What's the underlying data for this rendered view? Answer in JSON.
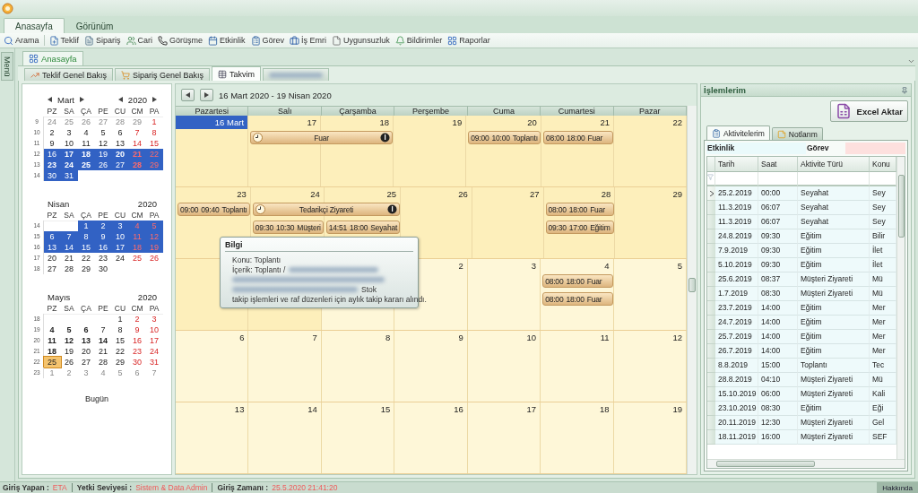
{
  "ribbon_tabs": [
    {
      "label": "Anasayfa",
      "selected": true
    },
    {
      "label": "Görünüm",
      "selected": false
    }
  ],
  "toolbar": [
    "Arama",
    "Teklif",
    "Sipariş",
    "Cari",
    "Görüşme",
    "Etkinlik",
    "Görev",
    "İş Emri",
    "Uygunsuzluk",
    "Bildirimler",
    "Raporlar"
  ],
  "side_strip": {
    "label": "Menü"
  },
  "document_tab": {
    "label": "Anasayfa"
  },
  "view_tabs": [
    {
      "label": "Teklif Genel Bakış",
      "selected": false
    },
    {
      "label": "Sipariş Genel Bakış",
      "selected": false
    },
    {
      "label": "Takvim",
      "selected": true
    }
  ],
  "mini_calendars": [
    {
      "month": "Mart",
      "year": "2020",
      "navigation": true,
      "weekdays": [
        "PZ",
        "SA",
        "ÇA",
        "PE",
        "CU",
        "CM",
        "PA"
      ],
      "weeks": [
        {
          "number": "9",
          "days": [
            {
              "label": "24",
              "muted": true,
              "bold": false,
              "selected": false,
              "today": false
            },
            {
              "label": "25",
              "muted": true,
              "bold": false,
              "selected": false,
              "today": false
            },
            {
              "label": "26",
              "muted": true,
              "bold": false,
              "selected": false,
              "today": false
            },
            {
              "label": "27",
              "muted": true,
              "bold": false,
              "selected": false,
              "today": false
            },
            {
              "label": "28",
              "muted": true,
              "bold": false,
              "selected": false,
              "today": false
            },
            {
              "label": "29",
              "muted": true,
              "bold": false,
              "selected": false,
              "today": false
            },
            {
              "label": "1",
              "muted": false,
              "bold": false,
              "selected": false,
              "today": false
            }
          ]
        },
        {
          "number": "10",
          "days": [
            {
              "label": "2",
              "muted": false,
              "bold": false,
              "selected": false,
              "today": false
            },
            {
              "label": "3",
              "muted": false,
              "bold": false,
              "selected": false,
              "today": false
            },
            {
              "label": "4",
              "muted": false,
              "bold": false,
              "selected": false,
              "today": false
            },
            {
              "label": "5",
              "muted": false,
              "bold": false,
              "selected": false,
              "today": false
            },
            {
              "label": "6",
              "muted": false,
              "bold": false,
              "selected": false,
              "today": false
            },
            {
              "label": "7",
              "muted": false,
              "bold": false,
              "selected": false,
              "today": false
            },
            {
              "label": "8",
              "muted": false,
              "bold": false,
              "selected": false,
              "today": false
            }
          ]
        },
        {
          "number": "11",
          "days": [
            {
              "label": "9",
              "muted": false,
              "bold": false,
              "selected": false,
              "today": false
            },
            {
              "label": "10",
              "muted": false,
              "bold": false,
              "selected": false,
              "today": false
            },
            {
              "label": "11",
              "muted": false,
              "bold": false,
              "selected": false,
              "today": false
            },
            {
              "label": "12",
              "muted": false,
              "bold": false,
              "selected": false,
              "today": false
            },
            {
              "label": "13",
              "muted": false,
              "bold": false,
              "selected": false,
              "today": false
            },
            {
              "label": "14",
              "muted": false,
              "bold": false,
              "selected": false,
              "today": false
            },
            {
              "label": "15",
              "muted": false,
              "bold": false,
              "selected": false,
              "today": false
            }
          ]
        },
        {
          "number": "12",
          "days": [
            {
              "label": "16",
              "muted": false,
              "bold": false,
              "selected": true,
              "today": false
            },
            {
              "label": "17",
              "muted": false,
              "bold": true,
              "selected": true,
              "today": false
            },
            {
              "label": "18",
              "muted": false,
              "bold": true,
              "selected": true,
              "today": false
            },
            {
              "label": "19",
              "muted": false,
              "bold": false,
              "selected": true,
              "today": false
            },
            {
              "label": "20",
              "muted": false,
              "bold": true,
              "selected": true,
              "today": false
            },
            {
              "label": "21",
              "muted": false,
              "bold": true,
              "selected": true,
              "today": false
            },
            {
              "label": "22",
              "muted": false,
              "bold": false,
              "selected": true,
              "today": false
            }
          ]
        },
        {
          "number": "13",
          "days": [
            {
              "label": "23",
              "muted": false,
              "bold": true,
              "selected": true,
              "today": false
            },
            {
              "label": "24",
              "muted": false,
              "bold": true,
              "selected": true,
              "today": false
            },
            {
              "label": "25",
              "muted": false,
              "bold": true,
              "selected": true,
              "today": false
            },
            {
              "label": "26",
              "muted": false,
              "bold": false,
              "selected": true,
              "today": false
            },
            {
              "label": "27",
              "muted": false,
              "bold": false,
              "selected": true,
              "today": false
            },
            {
              "label": "28",
              "muted": false,
              "bold": true,
              "selected": true,
              "today": false
            },
            {
              "label": "29",
              "muted": false,
              "bold": false,
              "selected": true,
              "today": false
            }
          ]
        },
        {
          "number": "14",
          "days": [
            {
              "label": "30",
              "muted": false,
              "bold": false,
              "selected": true,
              "today": false
            },
            {
              "label": "31",
              "muted": false,
              "bold": false,
              "selected": true,
              "today": false
            }
          ]
        }
      ]
    },
    {
      "month": "Nisan",
      "year": "2020",
      "navigation": false,
      "weekdays": [
        "PZ",
        "SA",
        "ÇA",
        "PE",
        "CU",
        "CM",
        "PA"
      ],
      "weeks": [
        {
          "number": "14",
          "days": [
            {
              "label": "1",
              "muted": false,
              "bold": false,
              "selected": true,
              "today": false
            },
            {
              "label": "2",
              "muted": false,
              "bold": false,
              "selected": true,
              "today": false
            },
            {
              "label": "3",
              "muted": false,
              "bold": false,
              "selected": true,
              "today": false
            },
            {
              "label": "4",
              "muted": false,
              "bold": false,
              "selected": true,
              "today": false
            },
            {
              "label": "5",
              "muted": false,
              "bold": false,
              "selected": true,
              "today": false
            }
          ]
        },
        {
          "number": "15",
          "days": [
            {
              "label": "6",
              "muted": false,
              "bold": false,
              "selected": true,
              "today": false
            },
            {
              "label": "7",
              "muted": false,
              "bold": false,
              "selected": true,
              "today": false
            },
            {
              "label": "8",
              "muted": false,
              "bold": false,
              "selected": true,
              "today": false
            },
            {
              "label": "9",
              "muted": false,
              "bold": false,
              "selected": true,
              "today": false
            },
            {
              "label": "10",
              "muted": false,
              "bold": false,
              "selected": true,
              "today": false
            },
            {
              "label": "11",
              "muted": false,
              "bold": false,
              "selected": true,
              "today": false
            },
            {
              "label": "12",
              "muted": false,
              "bold": false,
              "selected": true,
              "today": false
            }
          ]
        },
        {
          "number": "16",
          "days": [
            {
              "label": "13",
              "muted": false,
              "bold": false,
              "selected": true,
              "today": false
            },
            {
              "label": "14",
              "muted": false,
              "bold": false,
              "selected": true,
              "today": false
            },
            {
              "label": "15",
              "muted": false,
              "bold": false,
              "selected": true,
              "today": false
            },
            {
              "label": "16",
              "muted": false,
              "bold": false,
              "selected": true,
              "today": false
            },
            {
              "label": "17",
              "muted": false,
              "bold": false,
              "selected": true,
              "today": false
            },
            {
              "label": "18",
              "muted": false,
              "bold": false,
              "selected": true,
              "today": false
            },
            {
              "label": "19",
              "muted": false,
              "bold": false,
              "selected": true,
              "today": false
            }
          ]
        },
        {
          "number": "17",
          "days": [
            {
              "label": "20",
              "muted": false,
              "bold": false,
              "selected": false,
              "today": false
            },
            {
              "label": "21",
              "muted": false,
              "bold": false,
              "selected": false,
              "today": false
            },
            {
              "label": "22",
              "muted": false,
              "bold": false,
              "selected": false,
              "today": false
            },
            {
              "label": "23",
              "muted": false,
              "bold": false,
              "selected": false,
              "today": false
            },
            {
              "label": "24",
              "muted": false,
              "bold": false,
              "selected": false,
              "today": false
            },
            {
              "label": "25",
              "muted": false,
              "bold": false,
              "selected": false,
              "today": false
            },
            {
              "label": "26",
              "muted": false,
              "bold": false,
              "selected": false,
              "today": false
            }
          ]
        },
        {
          "number": "18",
          "days": [
            {
              "label": "27",
              "muted": false,
              "bold": false,
              "selected": false,
              "today": false
            },
            {
              "label": "28",
              "muted": false,
              "bold": false,
              "selected": false,
              "today": false
            },
            {
              "label": "29",
              "muted": false,
              "bold": false,
              "selected": false,
              "today": false
            },
            {
              "label": "30",
              "muted": false,
              "bold": false,
              "selected": false,
              "today": false
            }
          ]
        }
      ]
    },
    {
      "month": "Mayıs",
      "year": "2020",
      "navigation": false,
      "weekdays": [
        "PZ",
        "SA",
        "ÇA",
        "PE",
        "CU",
        "CM",
        "PA"
      ],
      "weeks": [
        {
          "number": "18",
          "days": [
            {
              "label": "1",
              "muted": false,
              "bold": false,
              "selected": false,
              "today": false
            },
            {
              "label": "2",
              "muted": false,
              "bold": false,
              "selected": false,
              "today": false
            },
            {
              "label": "3",
              "muted": false,
              "bold": false,
              "selected": false,
              "today": false
            }
          ]
        },
        {
          "number": "19",
          "days": [
            {
              "label": "4",
              "muted": false,
              "bold": true,
              "selected": false,
              "today": false
            },
            {
              "label": "5",
              "muted": false,
              "bold": true,
              "selected": false,
              "today": false
            },
            {
              "label": "6",
              "muted": false,
              "bold": true,
              "selected": false,
              "today": false
            },
            {
              "label": "7",
              "muted": false,
              "bold": false,
              "selected": false,
              "today": false
            },
            {
              "label": "8",
              "muted": false,
              "bold": false,
              "selected": false,
              "today": false
            },
            {
              "label": "9",
              "muted": false,
              "bold": false,
              "selected": false,
              "today": false
            },
            {
              "label": "10",
              "muted": false,
              "bold": false,
              "selected": false,
              "today": false
            }
          ]
        },
        {
          "number": "20",
          "days": [
            {
              "label": "11",
              "muted": false,
              "bold": true,
              "selected": false,
              "today": false
            },
            {
              "label": "12",
              "muted": false,
              "bold": true,
              "selected": false,
              "today": false
            },
            {
              "label": "13",
              "muted": false,
              "bold": true,
              "selected": false,
              "today": false
            },
            {
              "label": "14",
              "muted": false,
              "bold": true,
              "selected": false,
              "today": false
            },
            {
              "label": "15",
              "muted": false,
              "bold": false,
              "selected": false,
              "today": false
            },
            {
              "label": "16",
              "muted": false,
              "bold": false,
              "selected": false,
              "today": false
            },
            {
              "label": "17",
              "muted": false,
              "bold": false,
              "selected": false,
              "today": false
            }
          ]
        },
        {
          "number": "21",
          "days": [
            {
              "label": "18",
              "muted": false,
              "bold": true,
              "selected": false,
              "today": false
            },
            {
              "label": "19",
              "muted": false,
              "bold": false,
              "selected": false,
              "today": false
            },
            {
              "label": "20",
              "muted": false,
              "bold": false,
              "selected": false,
              "today": false
            },
            {
              "label": "21",
              "muted": false,
              "bold": false,
              "selected": false,
              "today": false
            },
            {
              "label": "22",
              "muted": false,
              "bold": false,
              "selected": false,
              "today": false
            },
            {
              "label": "23",
              "muted": false,
              "bold": false,
              "selected": false,
              "today": false
            },
            {
              "label": "24",
              "muted": false,
              "bold": false,
              "selected": false,
              "today": false
            }
          ]
        },
        {
          "number": "22",
          "days": [
            {
              "label": "25",
              "muted": false,
              "bold": false,
              "selected": false,
              "today": true
            },
            {
              "label": "26",
              "muted": false,
              "bold": false,
              "selected": false,
              "today": false
            },
            {
              "label": "27",
              "muted": false,
              "bold": false,
              "selected": false,
              "today": false
            },
            {
              "label": "28",
              "muted": false,
              "bold": false,
              "selected": false,
              "today": false
            },
            {
              "label": "29",
              "muted": false,
              "bold": false,
              "selected": false,
              "today": false
            },
            {
              "label": "30",
              "muted": false,
              "bold": false,
              "selected": false,
              "today": false
            },
            {
              "label": "31",
              "muted": false,
              "bold": false,
              "selected": false,
              "today": false
            }
          ]
        },
        {
          "number": "23",
          "days": [
            {
              "label": "1",
              "muted": true,
              "bold": false,
              "selected": false,
              "today": false
            },
            {
              "label": "2",
              "muted": true,
              "bold": false,
              "selected": false,
              "today": false
            },
            {
              "label": "3",
              "muted": true,
              "bold": false,
              "selected": false,
              "today": false
            },
            {
              "label": "4",
              "muted": true,
              "bold": false,
              "selected": false,
              "today": false
            },
            {
              "label": "5",
              "muted": true,
              "bold": false,
              "selected": false,
              "today": false
            },
            {
              "label": "6",
              "muted": true,
              "bold": false,
              "selected": false,
              "today": false
            },
            {
              "label": "7",
              "muted": true,
              "bold": false,
              "selected": false,
              "today": false
            }
          ]
        }
      ]
    }
  ],
  "today_link": "Bugün",
  "calendar": {
    "range": "16 Mart 2020 - 19 Nisan 2020",
    "weekdays": [
      "Pazartesi",
      "Salı",
      "Çarşamba",
      "Perşembe",
      "Cuma",
      "Cumartesi",
      "Pazar"
    ],
    "weeks": [
      {
        "cells": [
          {
            "date": "16 Mart",
            "selected": true,
            "shaded": true
          },
          {
            "date": "17",
            "selected": false,
            "shaded": true,
            "events": [
              {
                "kind": "two_day",
                "title": "Fuar"
              }
            ]
          },
          {
            "date": "18",
            "selected": false,
            "shaded": true
          },
          {
            "date": "19",
            "selected": false,
            "shaded": true
          },
          {
            "date": "20",
            "selected": false,
            "shaded": true,
            "events": [
              {
                "kind": "timed",
                "start": "09:00",
                "end": "10:00",
                "title": "Toplantı"
              }
            ]
          },
          {
            "date": "21",
            "selected": false,
            "shaded": true,
            "events": [
              {
                "kind": "timed",
                "start": "08:00",
                "end": "18:00",
                "title": "Fuar"
              }
            ]
          },
          {
            "date": "22",
            "selected": false,
            "shaded": true
          }
        ]
      },
      {
        "cells": [
          {
            "date": "23",
            "selected": false,
            "shaded": true,
            "events": [
              {
                "kind": "timed",
                "start": "09:00",
                "end": "09:40",
                "title": "Toplantı"
              }
            ]
          },
          {
            "date": "24",
            "selected": false,
            "shaded": true,
            "events": [
              {
                "kind": "two_day",
                "title": "Tedarikçi Ziyareti"
              },
              {
                "kind": "timed",
                "start": "09:30",
                "end": "10:30",
                "title": "Müşteri"
              }
            ]
          },
          {
            "date": "25",
            "selected": false,
            "shaded": true,
            "events": [
              {
                "kind": "spacer"
              },
              {
                "kind": "timed",
                "start": "14:51",
                "end": "18:00",
                "title": "Seyahat"
              }
            ]
          },
          {
            "date": "26",
            "selected": false,
            "shaded": true
          },
          {
            "date": "27",
            "selected": false,
            "shaded": true
          },
          {
            "date": "28",
            "selected": false,
            "shaded": true,
            "events": [
              {
                "kind": "timed",
                "start": "08:00",
                "end": "18:00",
                "title": "Fuar"
              },
              {
                "kind": "timed",
                "start": "09:30",
                "end": "17:00",
                "title": "Eğitim"
              }
            ]
          },
          {
            "date": "29",
            "selected": false,
            "shaded": true
          }
        ]
      },
      {
        "cells": [
          {
            "shaded": true
          },
          {
            "shaded": true
          },
          {
            "shaded": false
          },
          {
            "date": "2",
            "selected": false,
            "shaded": false
          },
          {
            "date": "3",
            "selected": false,
            "shaded": false
          },
          {
            "date": "4",
            "selected": false,
            "shaded": false,
            "events": [
              {
                "kind": "timed",
                "start": "08:00",
                "end": "18:00",
                "title": "Fuar"
              },
              {
                "kind": "timed",
                "start": "08:00",
                "end": "18:00",
                "title": "Fuar"
              }
            ]
          },
          {
            "date": "5",
            "selected": false,
            "shaded": false
          }
        ]
      },
      {
        "cells": [
          {
            "date": "6",
            "selected": false,
            "shaded": false
          },
          {
            "date": "7",
            "selected": false,
            "shaded": false
          },
          {
            "date": "8",
            "selected": false,
            "shaded": false
          },
          {
            "date": "9",
            "selected": false,
            "shaded": false
          },
          {
            "date": "10",
            "selected": false,
            "shaded": false
          },
          {
            "date": "11",
            "selected": false,
            "shaded": false
          },
          {
            "date": "12",
            "selected": false,
            "shaded": false
          }
        ]
      },
      {
        "cells": [
          {
            "date": "13",
            "selected": false,
            "shaded": false
          },
          {
            "date": "14",
            "selected": false,
            "shaded": false
          },
          {
            "date": "15",
            "selected": false,
            "shaded": false
          },
          {
            "date": "16",
            "selected": false,
            "shaded": false
          },
          {
            "date": "17",
            "selected": false,
            "shaded": false
          },
          {
            "date": "18",
            "selected": false,
            "shaded": false
          },
          {
            "date": "19",
            "selected": false,
            "shaded": false
          }
        ]
      }
    ]
  },
  "tooltip": {
    "title": "Bilgi",
    "lines": [
      {
        "kind": "text",
        "text": "Konu: Toplantı"
      },
      {
        "kind": "text_then_blur",
        "text": "İçerik: Toplantı /"
      },
      {
        "kind": "blur"
      },
      {
        "kind": "blur_then_text",
        "text": "Stok"
      },
      {
        "kind": "text",
        "text": "takip işlemleri ve raf düzenleri için aylık takip kararı alındı."
      }
    ]
  },
  "panel": {
    "title": "İşlemlerim",
    "export_button": "Excel Aktar",
    "tabs": [
      {
        "label": "Aktivitelerim",
        "selected": true
      },
      {
        "label": "Notlarım",
        "selected": false
      }
    ],
    "filters": [
      "Etkinlik",
      "Görev"
    ],
    "columns": [
      "Tarih",
      "Saat",
      "Aktivite Türü",
      "Konu"
    ],
    "rows": [
      {
        "selected": true,
        "cells": [
          "25.2.2019",
          "00:00",
          "Seyahat",
          "Sey"
        ]
      },
      {
        "selected": false,
        "cells": [
          "11.3.2019",
          "06:07",
          "Seyahat",
          "Sey"
        ]
      },
      {
        "selected": false,
        "cells": [
          "11.3.2019",
          "06:07",
          "Seyahat",
          "Sey"
        ]
      },
      {
        "selected": false,
        "cells": [
          "24.8.2019",
          "09:30",
          "Eğitim",
          "Bilir"
        ]
      },
      {
        "selected": false,
        "cells": [
          "7.9.2019",
          "09:30",
          "Eğitim",
          "İlet"
        ]
      },
      {
        "selected": false,
        "cells": [
          "5.10.2019",
          "09:30",
          "Eğitim",
          "İlet"
        ]
      },
      {
        "selected": false,
        "cells": [
          "25.6.2019",
          "08:37",
          "Müşteri Ziyareti",
          "Mü"
        ]
      },
      {
        "selected": false,
        "cells": [
          "1.7.2019",
          "08:30",
          "Müşteri Ziyareti",
          "Mü"
        ]
      },
      {
        "selected": false,
        "cells": [
          "23.7.2019",
          "14:00",
          "Eğitim",
          "Mer"
        ]
      },
      {
        "selected": false,
        "cells": [
          "24.7.2019",
          "14:00",
          "Eğitim",
          "Mer"
        ]
      },
      {
        "selected": false,
        "cells": [
          "25.7.2019",
          "14:00",
          "Eğitim",
          "Mer"
        ]
      },
      {
        "selected": false,
        "cells": [
          "26.7.2019",
          "14:00",
          "Eğitim",
          "Mer"
        ]
      },
      {
        "selected": false,
        "cells": [
          "8.8.2019",
          "15:00",
          "Toplantı",
          "Tec"
        ]
      },
      {
        "selected": false,
        "cells": [
          "28.8.2019",
          "04:10",
          "Müşteri Ziyareti",
          "Mü"
        ]
      },
      {
        "selected": false,
        "cells": [
          "15.10.2019",
          "06:00",
          "Müşteri Ziyareti",
          "Kali"
        ]
      },
      {
        "selected": false,
        "cells": [
          "23.10.2019",
          "08:30",
          "Eğitim",
          "Eği"
        ]
      },
      {
        "selected": false,
        "cells": [
          "20.11.2019",
          "12:30",
          "Müşteri Ziyareti",
          "Gel"
        ]
      },
      {
        "selected": false,
        "cells": [
          "18.11.2019",
          "16:00",
          "Müşteri Ziyareti",
          "SEF"
        ]
      }
    ]
  },
  "status_bar": {
    "items": [
      {
        "label": "Giriş Yapan :",
        "value": "ETA"
      },
      {
        "label": "Yetki Seviyesi :",
        "value": "Sistem & Data Admin"
      },
      {
        "label": "Giriş Zamanı :",
        "value": "25.5.2020 21:41:20"
      }
    ],
    "about_button": "Hakkında"
  }
}
